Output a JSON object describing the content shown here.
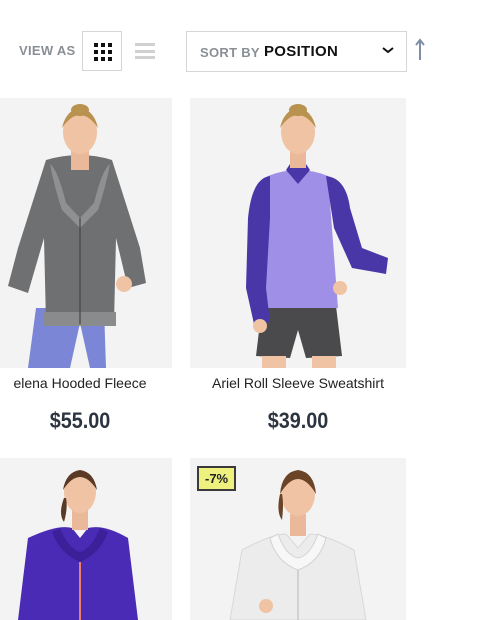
{
  "toolbar": {
    "view_as_label": "VIEW AS",
    "sort_by_label": "SORT BY",
    "sort_value": "POSITION",
    "grid_icon": "grid-icon",
    "list_icon": "list-icon",
    "chevron_icon": "chevron-down-icon",
    "sort_direction_icon": "arrow-up-icon"
  },
  "products": [
    {
      "name": "elena Hooded Fleece",
      "price": "$55.00",
      "badge": "",
      "colors": {
        "top": "#6f7072",
        "bottom": "#7b86d6"
      }
    },
    {
      "name": "Ariel Roll Sleeve Sweatshirt",
      "price": "$39.00",
      "badge": "",
      "colors": {
        "top": "#a08fe6",
        "sleeve": "#4a37a7",
        "bottom": "#4a4a4c"
      }
    },
    {
      "name": "",
      "price": "",
      "badge": "",
      "colors": {
        "top": "#4a2bb5"
      }
    },
    {
      "name": "",
      "price": "",
      "badge": "-7%",
      "colors": {
        "top": "#ececec"
      }
    }
  ],
  "colors": {
    "badge_bg": "#eef17d",
    "label_gray": "#8a8f96",
    "price": "#2b3440"
  }
}
